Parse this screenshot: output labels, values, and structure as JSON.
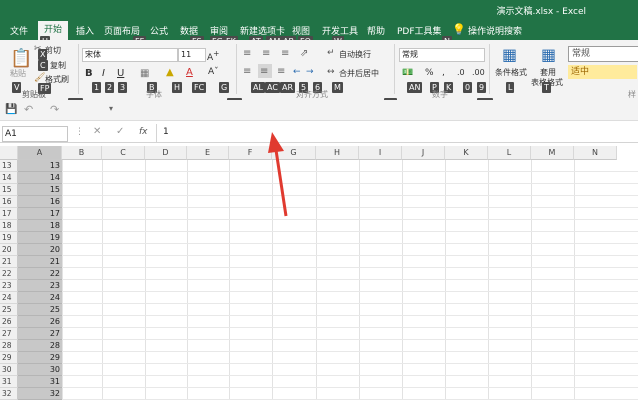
{
  "title_bar": {
    "title": "演示文稿.xlsx - Excel"
  },
  "menu": {
    "items": [
      "文件",
      "开始",
      "插入",
      "页面布局",
      "公式",
      "数据",
      "审阅",
      "新建选项卡",
      "视图",
      "开发工具",
      "帮助",
      "PDF工具集"
    ],
    "search": "操作说明搜索"
  },
  "keytips": {
    "menu_h": "H",
    "menu_ff": "FF",
    "menu_fs": "FS",
    "menu_fg": "FG",
    "menu_fk": "FK",
    "menu_at": "AT",
    "menu_am": "AM",
    "menu_ab": "AB",
    "menu_fq": "FQ",
    "menu_w": "W",
    "menu_n": "N",
    "paste": "V",
    "cut": "X",
    "copy": "C",
    "format_painter": "FP",
    "clipboard_launcher": "FO",
    "num1": "1",
    "num2": "2",
    "num3": "3",
    "border": "B",
    "fill": "H",
    "fontcolor": "FC",
    "grow": "G",
    "font_launcher": "FN",
    "al": "AL",
    "ac": "AC",
    "ar": "AR",
    "n5": "5",
    "n6": "6",
    "m": "M",
    "fa": "FA",
    "an": "AN",
    "p": "P",
    "k": "K",
    "n0": "0",
    "n9": "9",
    "fm": "FM",
    "l": "L",
    "t": "T"
  },
  "ribbon": {
    "paste": "粘贴",
    "cut": "剪切",
    "copy": "复制",
    "format_painter": "格式刷",
    "clipboard_group": "剪贴板",
    "font_name": "宋体",
    "font_size": "11",
    "font_group": "字体",
    "bold": "B",
    "italic": "I",
    "underline": "U",
    "wrap_text": "自动换行",
    "merge_center": "合并后居中",
    "align_group": "对齐方式",
    "number_format": "常规",
    "number_group": "数字",
    "cond_format": "条件格式",
    "table_format_1": "套用",
    "table_format_2": "表格格式",
    "style_normal": "常规",
    "style_medium": "适中",
    "styles_group": "样"
  },
  "formula_bar": {
    "name_box": "A1",
    "fx": "fx",
    "value": "1"
  },
  "grid": {
    "columns": [
      "A",
      "B",
      "C",
      "D",
      "E",
      "F",
      "G",
      "H",
      "I",
      "J",
      "K",
      "L",
      "M",
      "N"
    ],
    "row_numbers": [
      "13",
      "14",
      "15",
      "16",
      "17",
      "18",
      "19",
      "20",
      "21",
      "22",
      "23",
      "24",
      "25",
      "26",
      "27",
      "28",
      "29",
      "30",
      "31",
      "32"
    ],
    "col_a_values": [
      "13",
      "14",
      "15",
      "16",
      "17",
      "18",
      "19",
      "20",
      "21",
      "22",
      "23",
      "24",
      "25",
      "26",
      "27",
      "28",
      "29",
      "30",
      "31",
      "32"
    ]
  },
  "colors": {
    "accent": "#217346",
    "arrow": "#e03a2f"
  }
}
